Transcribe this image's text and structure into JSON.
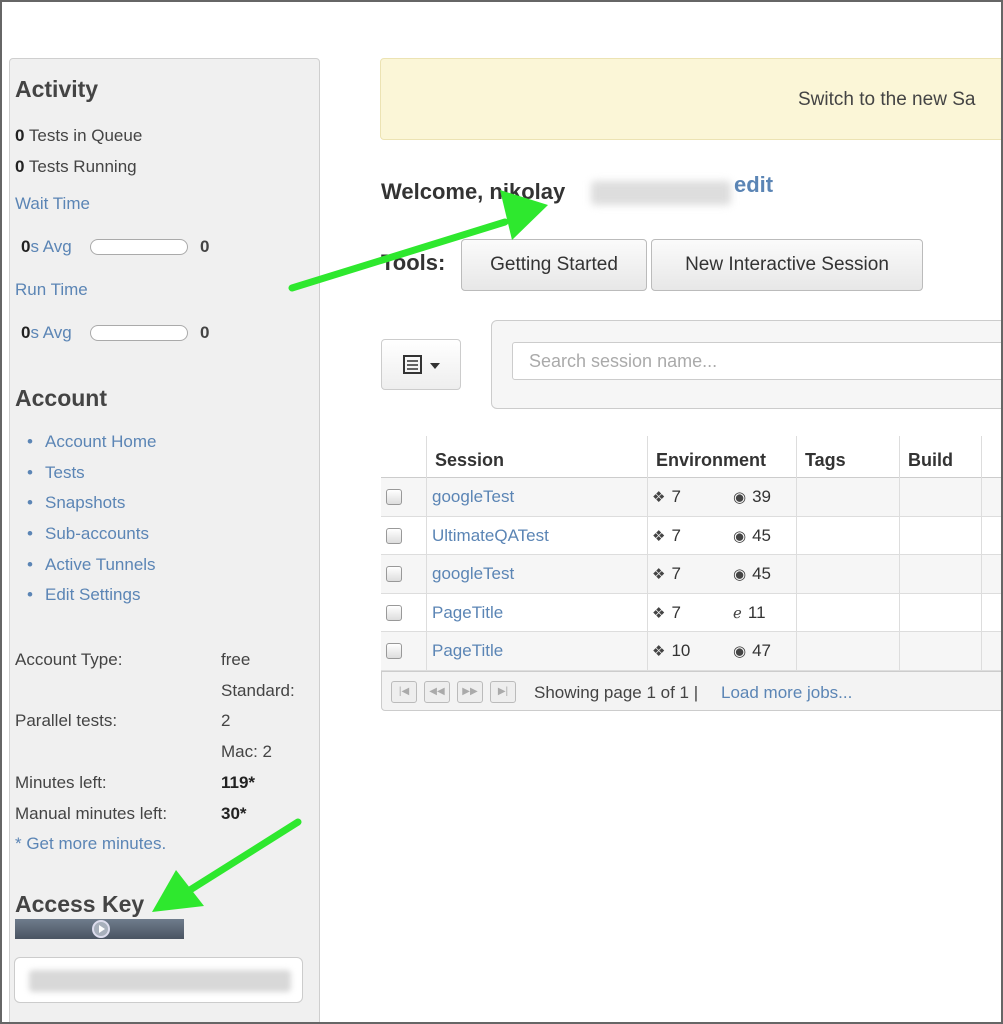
{
  "sidebar": {
    "activity": {
      "title": "Activity",
      "queue_count": "0",
      "queue_label": " Tests in Queue",
      "running_count": "0",
      "running_label": " Tests Running",
      "wait_time_link": "Wait Time",
      "wait_avg_value": "0",
      "wait_avg_label": "s Avg",
      "wait_count": "0",
      "run_time_link": "Run Time",
      "run_avg_value": "0",
      "run_avg_label": "s Avg",
      "run_count": "0"
    },
    "account": {
      "title": "Account",
      "links": [
        "Account Home",
        "Tests",
        "Snapshots",
        "Sub-accounts",
        "Active Tunnels",
        "Edit Settings"
      ],
      "type_label": "Account Type:",
      "type_value": "free",
      "standard_label": "Standard:",
      "parallel_label": "Parallel tests:",
      "parallel_value": "2",
      "mac_label": "Mac: 2",
      "minutes_label": "Minutes left:",
      "minutes_value": "119*",
      "manual_label": "Manual minutes left:",
      "manual_value": "30*",
      "more_minutes_link": "* Get more minutes."
    },
    "access_key": {
      "title": "Access Key"
    }
  },
  "banner": {
    "text": "Switch to the new Sa"
  },
  "welcome": {
    "text": "Welcome, nikolay",
    "edit_link": "edit"
  },
  "tools": {
    "label": "Tools:",
    "getting_started": "Getting Started",
    "new_session": "New Interactive Session"
  },
  "search": {
    "placeholder": "Search session name..."
  },
  "table": {
    "headers": [
      "Session",
      "Environment",
      "Tags",
      "Build"
    ],
    "rows": [
      {
        "session": "googleTest",
        "os_version": "7",
        "browser_version": "39",
        "browser_icon": "chrome-icon"
      },
      {
        "session": "UltimateQATest",
        "os_version": "7",
        "browser_version": "45",
        "browser_icon": "chrome-icon"
      },
      {
        "session": "googleTest",
        "os_version": "7",
        "browser_version": "45",
        "browser_icon": "chrome-icon"
      },
      {
        "session": "PageTitle",
        "os_version": "7",
        "browser_version": "11",
        "browser_icon": "ie-icon"
      },
      {
        "session": "PageTitle",
        "os_version": "10",
        "browser_version": "47",
        "browser_icon": "chrome-icon"
      }
    ],
    "pager_text": "Showing page 1 of 1 |",
    "load_more": "Load more jobs..."
  },
  "colors": {
    "link": "#5b85b5",
    "arrow": "#22dd22",
    "banner": "#fbf6d7"
  }
}
